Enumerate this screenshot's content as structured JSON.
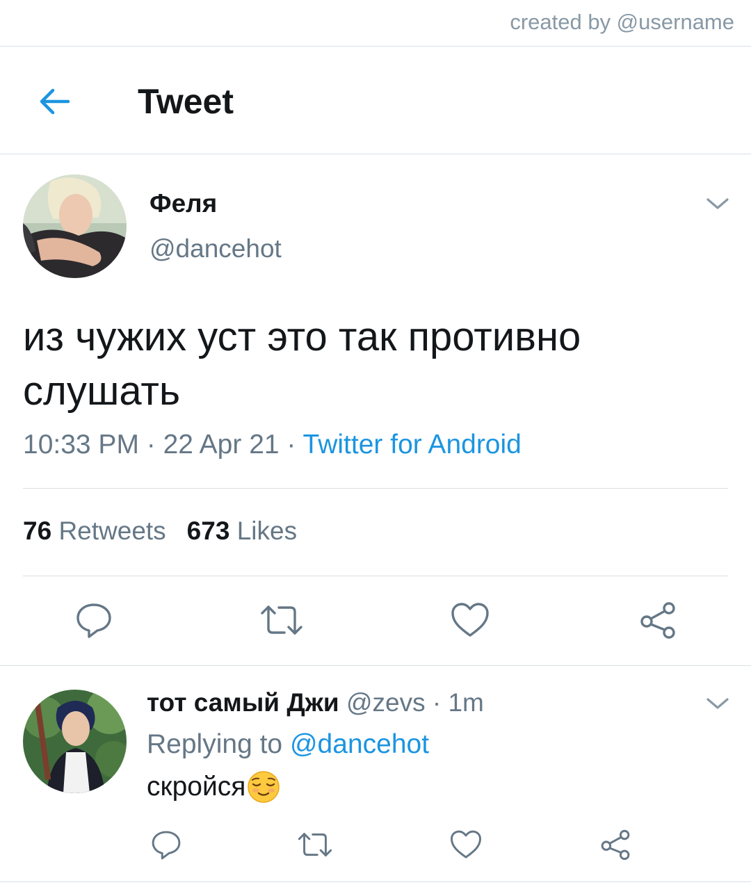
{
  "credit": "created by @username",
  "header": {
    "title": "Tweet",
    "back_icon": "arrow-left-icon"
  },
  "tweet": {
    "author_name": "Феля",
    "author_handle": "@dancehot",
    "text": "из чужих уст это так противно слушать",
    "time": "10:33 PM",
    "date": "22 Apr 21",
    "source": "Twitter for Android",
    "retweets_count": "76",
    "retweets_label": "Retweets",
    "likes_count": "673",
    "likes_label": "Likes",
    "actions": [
      "reply-icon",
      "retweet-icon",
      "like-icon",
      "share-icon"
    ]
  },
  "reply": {
    "author_name": "тот самый Джи",
    "author_handle": "@zevs",
    "time": "1m",
    "replying_label": "Replying to",
    "replying_handle": "@dancehot",
    "text": "скройся",
    "emoji": "relieved-face-emoji"
  },
  "colors": {
    "accent": "#1b95e0",
    "text_primary": "#14171a",
    "text_secondary": "#657786",
    "divider": "#d9dfe3"
  }
}
